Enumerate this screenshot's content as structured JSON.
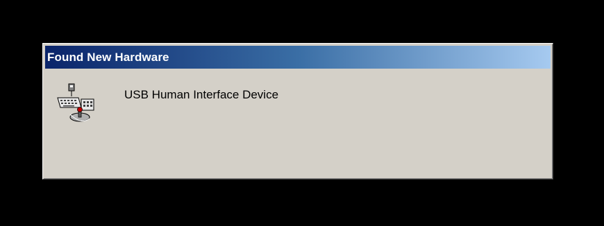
{
  "dialog": {
    "title": "Found New Hardware",
    "device_name": "USB Human Interface Device",
    "icon": "usb-hardware-icon"
  },
  "colors": {
    "background": "#000000",
    "dialog_face": "#d4d0c8",
    "titlebar_start": "#0a246a",
    "titlebar_end": "#a6caf0",
    "title_text": "#ffffff"
  }
}
